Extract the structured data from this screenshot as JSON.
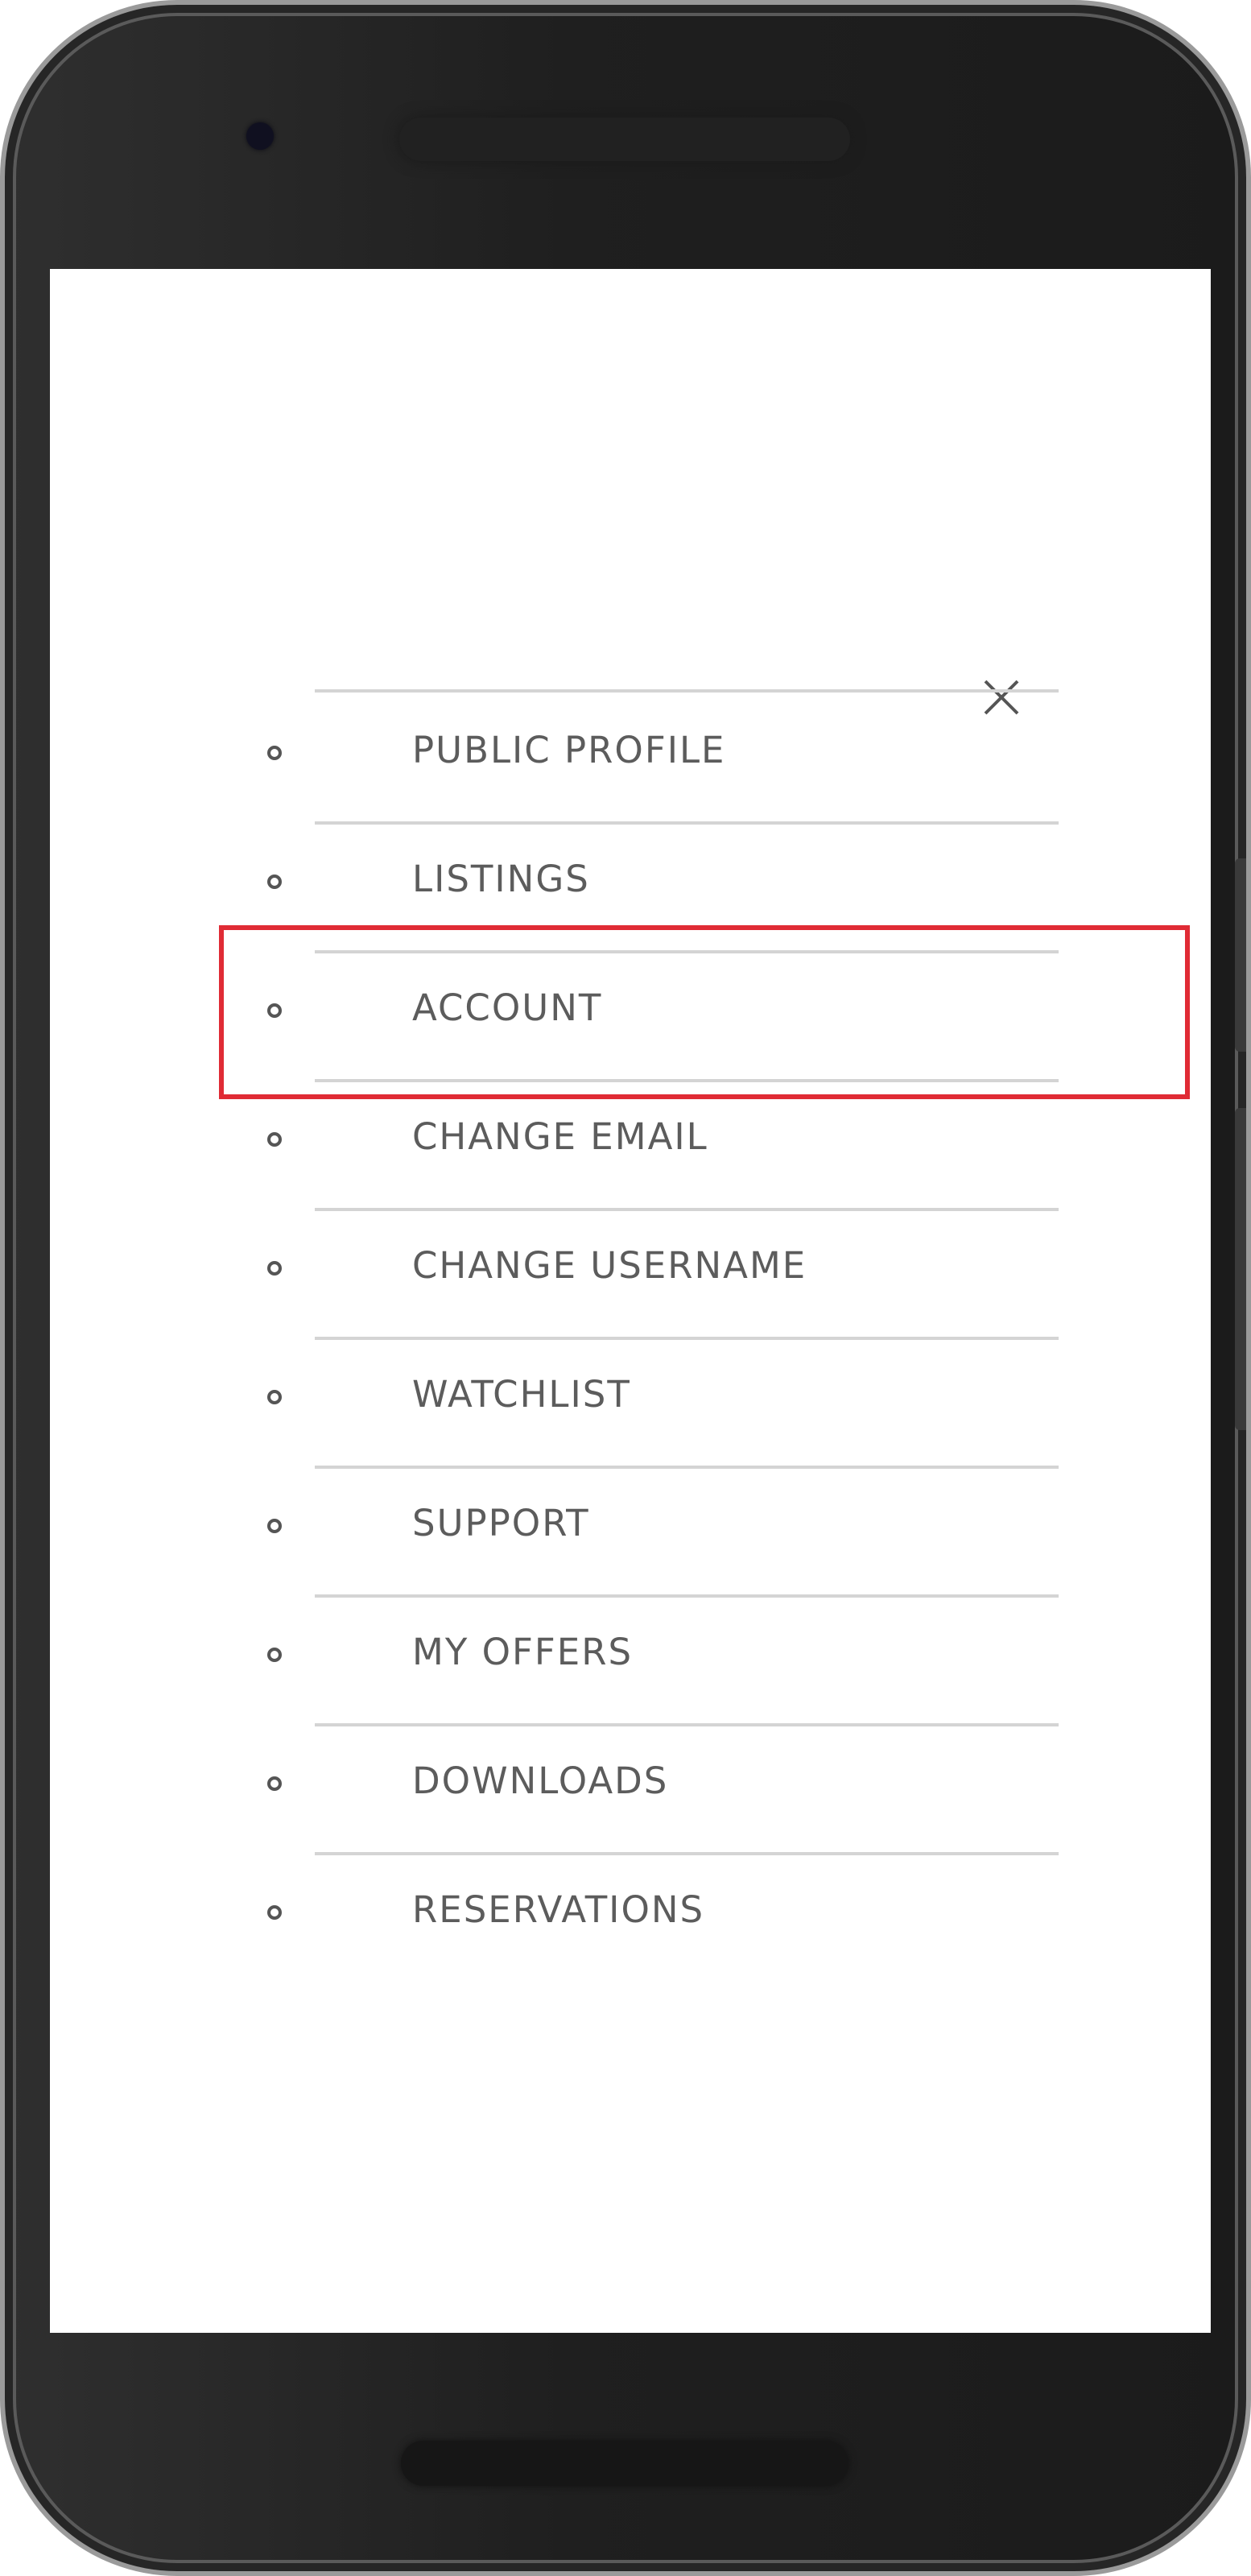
{
  "menu": {
    "items": [
      {
        "label": "PUBLIC PROFILE"
      },
      {
        "label": "LISTINGS"
      },
      {
        "label": "ACCOUNT"
      },
      {
        "label": "CHANGE EMAIL"
      },
      {
        "label": "CHANGE USERNAME"
      },
      {
        "label": "WATCHLIST"
      },
      {
        "label": "SUPPORT"
      },
      {
        "label": "MY OFFERS"
      },
      {
        "label": "DOWNLOADS"
      },
      {
        "label": "RESERVATIONS"
      }
    ],
    "highlighted_item": "ACCOUNT"
  },
  "icons": {
    "close": "close-icon",
    "bullet": "hollow-circle-bullet-icon"
  },
  "colors": {
    "highlight_border": "#e02b35",
    "menu_text": "#5c5c5c",
    "divider": "#d4d4d4"
  }
}
